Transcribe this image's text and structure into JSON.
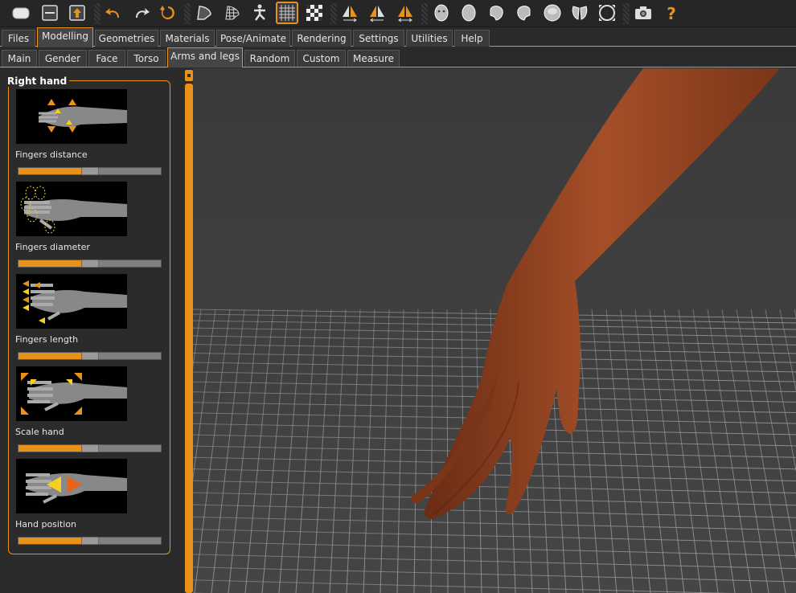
{
  "toolbar": {
    "icons": [
      "new-file-icon",
      "save-icon",
      "export-icon",
      "undo-icon",
      "redo-icon",
      "reset-icon",
      "smooth-icon",
      "wireframe-icon",
      "pose-icon",
      "grid-icon",
      "checker-icon",
      "symmetry-right-icon",
      "symmetry-left-icon",
      "symmetry-icon",
      "front-view-icon",
      "back-view-icon",
      "left-view-icon",
      "right-view-icon",
      "top-view-icon",
      "bottom-view-icon",
      "reset-camera-icon",
      "screenshot-icon",
      "help-icon"
    ],
    "active": [
      "grid-icon"
    ],
    "accent": "#e8921c"
  },
  "main_tabs": [
    {
      "label": "Files"
    },
    {
      "label": "Modelling"
    },
    {
      "label": "Geometries"
    },
    {
      "label": "Materials"
    },
    {
      "label": "Pose/Animate"
    },
    {
      "label": "Rendering"
    },
    {
      "label": "Settings"
    },
    {
      "label": "Utilities"
    },
    {
      "label": "Help"
    }
  ],
  "main_active": "Modelling",
  "sub_tabs": [
    {
      "label": "Main"
    },
    {
      "label": "Gender"
    },
    {
      "label": "Face"
    },
    {
      "label": "Torso"
    },
    {
      "label": "Arms and legs"
    },
    {
      "label": "Random"
    },
    {
      "label": "Custom"
    },
    {
      "label": "Measure"
    }
  ],
  "sub_active": "Arms and legs",
  "panel": {
    "title": "Right hand",
    "modifiers": [
      {
        "label": "Fingers distance",
        "value": 0.5
      },
      {
        "label": "Fingers diameter",
        "value": 0.5
      },
      {
        "label": "Fingers length",
        "value": 0.5
      },
      {
        "label": "Scale hand",
        "value": 0.5
      },
      {
        "label": "Hand position",
        "value": 0.5
      }
    ]
  },
  "colors": {
    "accent": "#e8921c",
    "skin": "#8a3e1e",
    "background": "#2b2b2b"
  }
}
